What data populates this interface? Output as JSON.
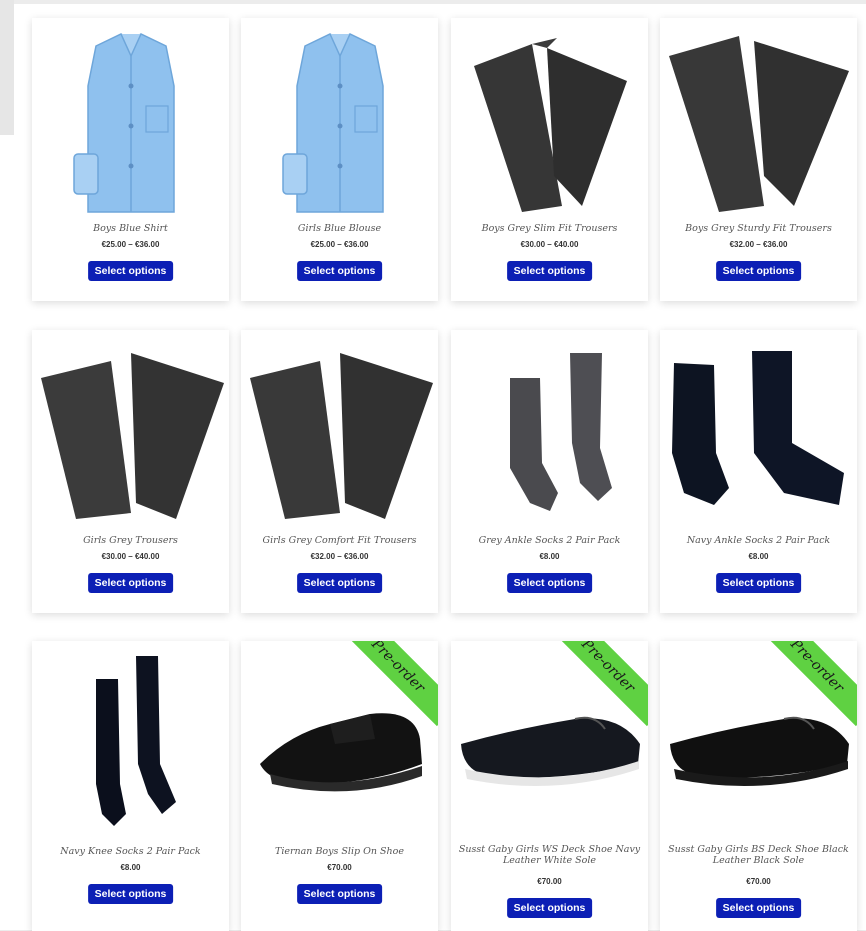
{
  "products": [
    {
      "title": "Boys Blue Shirt",
      "price": "€25.00 – €36.00",
      "button": "Select options",
      "image": "blue-shirt-icon",
      "preorder": false
    },
    {
      "title": "Girls Blue Blouse",
      "price": "€25.00 – €36.00",
      "button": "Select options",
      "image": "blue-blouse-icon",
      "preorder": false
    },
    {
      "title": "Boys Grey Slim Fit Trousers",
      "price": "€30.00 – €40.00",
      "button": "Select options",
      "image": "trousers-icon",
      "preorder": false
    },
    {
      "title": "Boys Grey Sturdy Fit Trousers",
      "price": "€32.00 – €36.00",
      "button": "Select options",
      "image": "trousers-icon",
      "preorder": false
    },
    {
      "title": "Girls Grey Trousers",
      "price": "€30.00 – €40.00",
      "button": "Select options",
      "image": "trousers-icon",
      "preorder": false
    },
    {
      "title": "Girls Grey Comfort Fit Trousers",
      "price": "€32.00 – €36.00",
      "button": "Select options",
      "image": "trousers-icon",
      "preorder": false
    },
    {
      "title": "Grey Ankle Socks 2 Pair Pack",
      "price": "€8.00",
      "button": "Select options",
      "image": "grey-socks-icon",
      "preorder": false
    },
    {
      "title": "Navy Ankle Socks 2 Pair Pack",
      "price": "€8.00",
      "button": "Select options",
      "image": "navy-socks-icon",
      "preorder": false
    },
    {
      "title": "Navy Knee Socks 2 Pair Pack",
      "price": "€8.00",
      "button": "Select options",
      "image": "knee-socks-icon",
      "preorder": false
    },
    {
      "title": "Tiernan Boys Slip On Shoe",
      "price": "€70.00",
      "button": "Select options",
      "image": "slip-on-shoe-icon",
      "preorder": true,
      "badge": "Pre-order"
    },
    {
      "title": "Susst Gaby Girls WS Deck Shoe Navy Leather White Sole",
      "price": "€70.00",
      "button": "Select options",
      "image": "deck-shoe-icon",
      "preorder": true,
      "badge": "Pre-order"
    },
    {
      "title": "Susst Gaby Girls BS Deck Shoe Black Leather Black Sole",
      "price": "€70.00",
      "button": "Select options",
      "image": "deck-shoe-black-icon",
      "preorder": true,
      "badge": "Pre-order"
    }
  ],
  "colors": {
    "button": "#0c1fb5",
    "badge": "#5fd142"
  }
}
